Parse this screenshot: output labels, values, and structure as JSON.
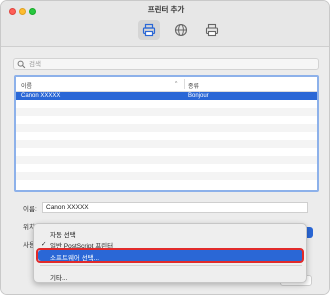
{
  "window": {
    "title": "프린터 추가"
  },
  "toolbar": {
    "buttons": [
      {
        "name": "default-printer",
        "active": true
      },
      {
        "name": "ip-printer",
        "active": false
      },
      {
        "name": "windows-printer",
        "active": false
      }
    ]
  },
  "search": {
    "placeholder": "검색",
    "value": ""
  },
  "table": {
    "headers": {
      "name": "이름",
      "kind": "종류"
    },
    "rows": [
      {
        "name": "Canon XXXXX",
        "kind": "Bonjour",
        "selected": true
      }
    ]
  },
  "form": {
    "name_label": "이름:",
    "name_value": "Canon XXXXX",
    "location_label": "위치:",
    "use_label": "사용"
  },
  "menu": {
    "items": [
      {
        "label": "자동 선택",
        "checked": false
      },
      {
        "label": "일반 PostScript 프린터",
        "checked": true
      },
      {
        "label": "소프트웨어 선택...",
        "highlighted": true
      },
      {
        "label": "기타..."
      }
    ],
    "check_glyph": "✓"
  },
  "colors": {
    "accent": "#2a67d6",
    "focus_ring": "#8db1ea",
    "annotation": "#e12a2a"
  }
}
